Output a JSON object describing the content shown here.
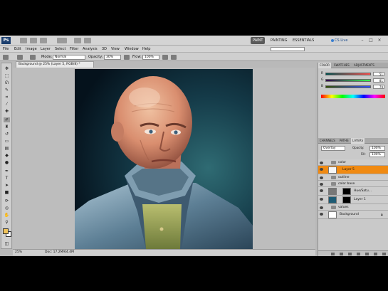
{
  "app": {
    "logo": "Ps",
    "workspaces": [
      "PAINT",
      "PAINTING",
      "ESSENTIALS"
    ],
    "cs_live": "CS Live",
    "window_controls": [
      "–",
      "□",
      "×"
    ]
  },
  "menu": [
    "File",
    "Edit",
    "Image",
    "Layer",
    "Select",
    "Filter",
    "Analysis",
    "3D",
    "View",
    "Window",
    "Help"
  ],
  "options": {
    "mode_label": "Mode:",
    "mode_value": "Normal",
    "opacity_label": "Opacity:",
    "opacity_value": "30%",
    "flow_label": "Flow:",
    "flow_value": "100%"
  },
  "document": {
    "tab_label": "Background @ 25% (Layer 5, RGB/8) *",
    "zoom": "25%",
    "doc_size": "Doc: 17.2M/64.4M"
  },
  "color_panel": {
    "tabs": [
      "COLOR",
      "SWATCHES",
      "ADJUSTMENTS"
    ],
    "sliders": [
      {
        "label": "R",
        "value": "51"
      },
      {
        "label": "G",
        "value": "81"
      },
      {
        "label": "B",
        "value": "79"
      }
    ]
  },
  "layers_panel": {
    "tabs": [
      "CHANNELS",
      "PATHS",
      "LAYERS"
    ],
    "blend_mode": "Overlay",
    "opacity_label": "Opacity:",
    "opacity_value": "100%",
    "fill_label": "Fill:",
    "fill_value": "100%",
    "layers": [
      {
        "name": "color",
        "type": "group"
      },
      {
        "name": "Layer 5",
        "type": "layer",
        "selected": true
      },
      {
        "name": "outline",
        "type": "group"
      },
      {
        "name": "color base",
        "type": "group"
      },
      {
        "name": "Hue/Satu...",
        "type": "adjustment"
      },
      {
        "name": "Layer 1",
        "type": "layer"
      },
      {
        "name": "values",
        "type": "group"
      },
      {
        "name": "Background",
        "type": "background"
      }
    ]
  },
  "colors": {
    "selected_layer": "#f08a12",
    "foreground": "#f1c45a",
    "background": "#ffffff"
  }
}
